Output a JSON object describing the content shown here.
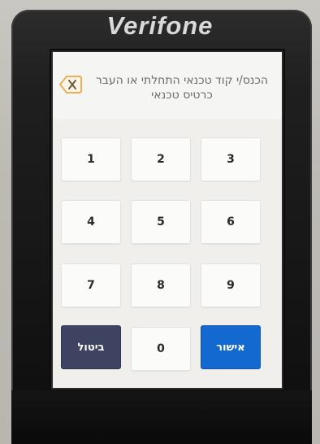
{
  "device": {
    "brand": "Verifone"
  },
  "screen": {
    "prompt": "הכנס/י קוד טכנאי התחלתי או העבר כרטיס טכנאי",
    "back_icon": "backspace-x-icon",
    "keypad": {
      "keys": [
        "1",
        "2",
        "3",
        "4",
        "5",
        "6",
        "7",
        "8",
        "9"
      ],
      "zero": "0",
      "cancel_label": "ביטול",
      "ok_label": "אישור"
    }
  },
  "colors": {
    "cancel": "#3d4360",
    "ok": "#1469d1",
    "back_icon": "#e8b25a"
  }
}
